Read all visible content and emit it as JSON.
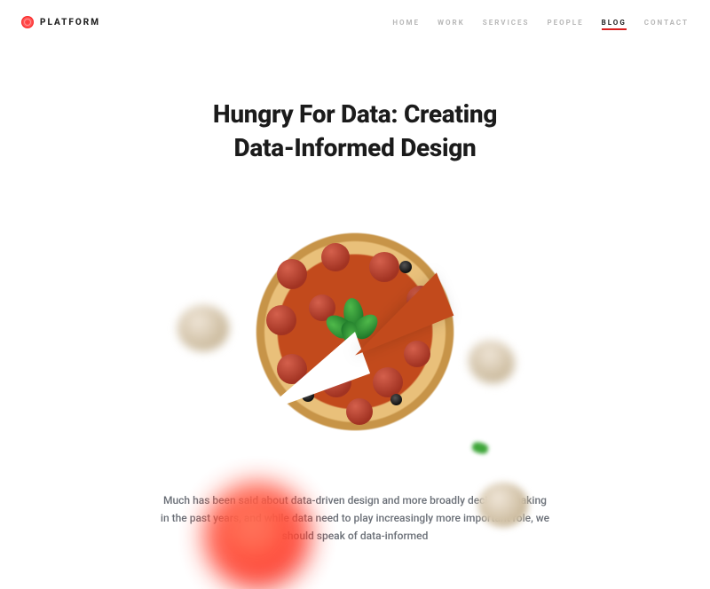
{
  "brand": {
    "name": "PLATFORM"
  },
  "nav": {
    "items": [
      {
        "label": "HOME",
        "active": false
      },
      {
        "label": "WORK",
        "active": false
      },
      {
        "label": "SERVICES",
        "active": false
      },
      {
        "label": "PEOPLE",
        "active": false
      },
      {
        "label": "BLOG",
        "active": true
      },
      {
        "label": "CONTACT",
        "active": false
      }
    ]
  },
  "article": {
    "title_line1": "Hungry For Data: Creating",
    "title_line2": "Data-Informed Design",
    "body": "Much has been said about data-driven design and more broadly decision-making in the past years, and while data need to play increasingly more important role, we should speak of data-informed"
  }
}
